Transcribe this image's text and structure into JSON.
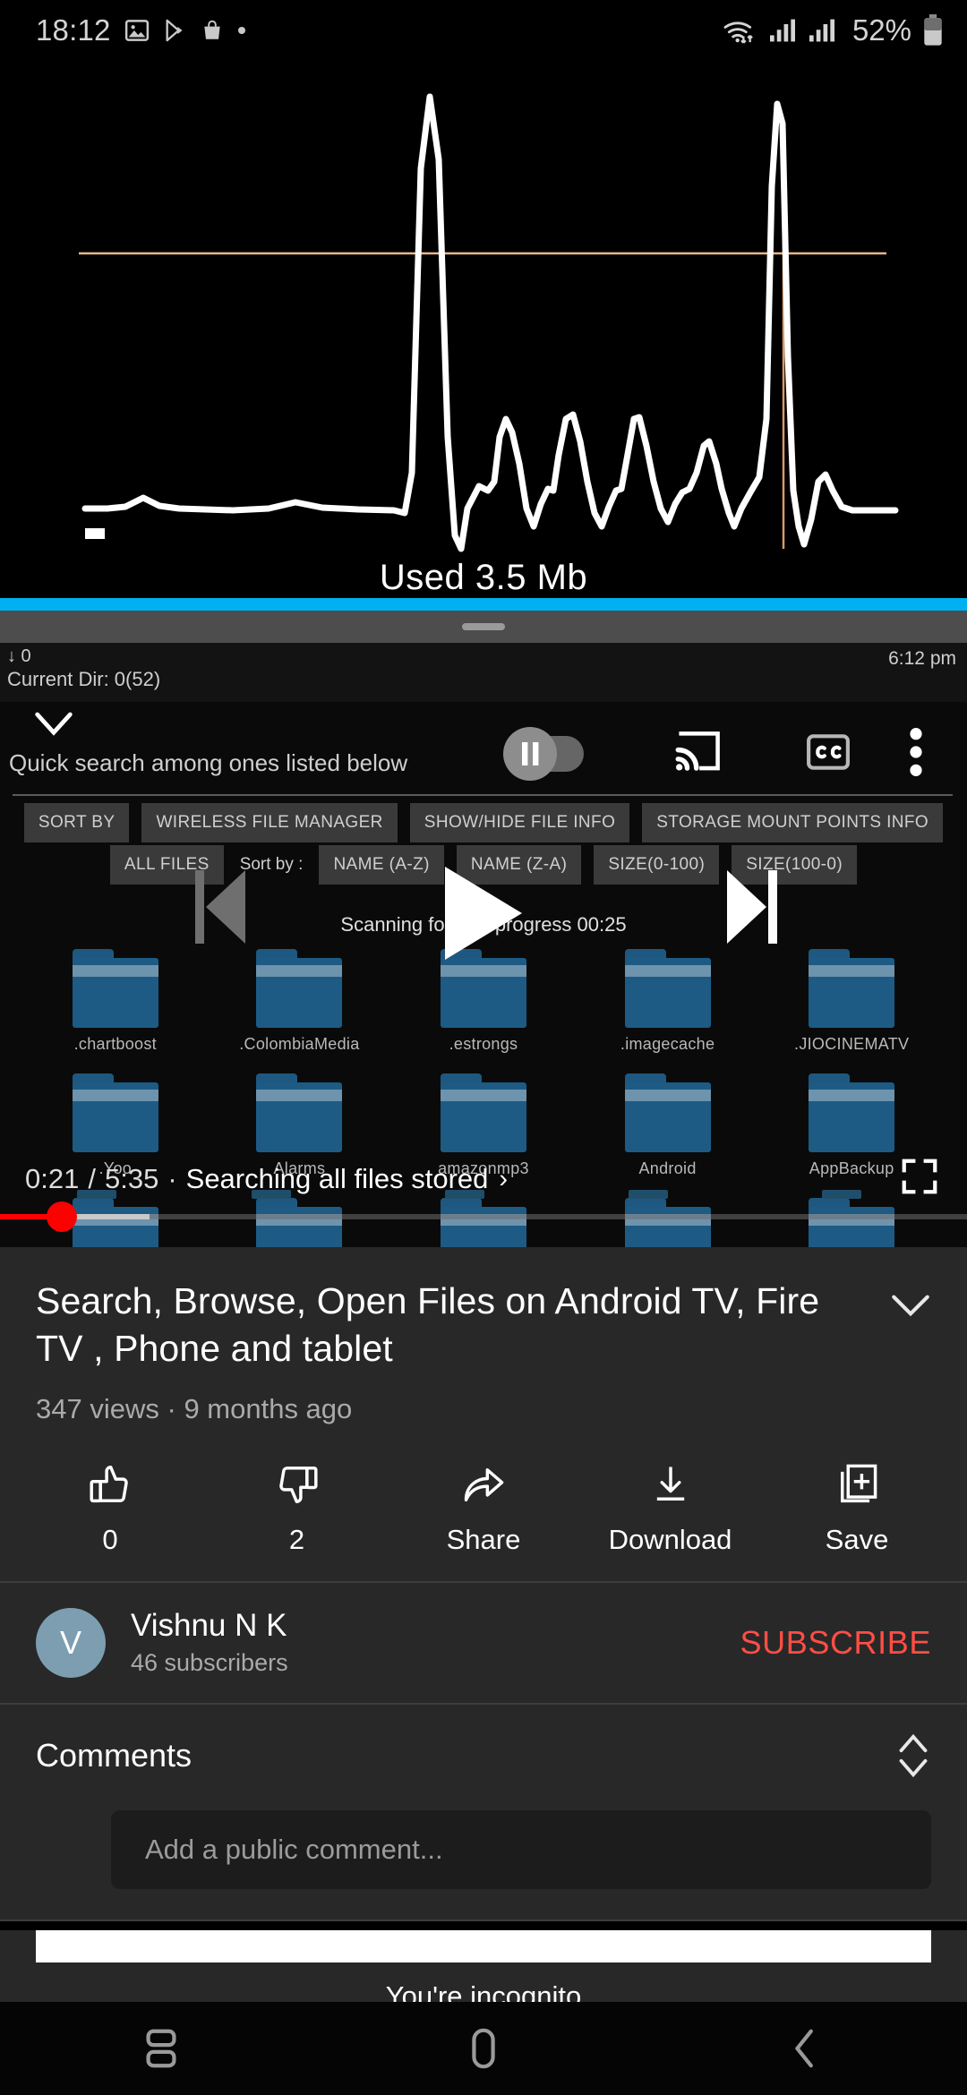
{
  "status_bar": {
    "time": "18:12",
    "battery_percent": "52%",
    "icons": [
      "photos-icon",
      "play-store-icon",
      "shopping-bag-icon",
      "dot-icon",
      "wifi-icon",
      "signal-icon",
      "signal-icon-2",
      "battery-icon"
    ]
  },
  "video": {
    "overlay": {
      "current_time": "0:21",
      "separator": "/",
      "duration": "5:35",
      "dot": "·",
      "chapter": "Searching all files stored",
      "chapter_chevron": "›"
    },
    "content": {
      "used_label": "Used 3.5 Mb",
      "file_manager": {
        "download_count": "↓ 0",
        "current_dir": "Current Dir: 0(52)",
        "clock": "6:12 pm",
        "search_placeholder": "Quick search among ones listed below",
        "toolbar_buttons": [
          "SORT BY",
          "WIRELESS FILE MANAGER",
          "SHOW/HIDE FILE INFO",
          "STORAGE MOUNT POINTS INFO"
        ],
        "filter_button": "ALL FILES",
        "sort_label": "Sort by :",
        "sort_buttons": [
          "NAME (A-Z)",
          "NAME (Z-A)",
          "SIZE(0-100)",
          "SIZE(100-0)"
        ],
        "scanning_text": "Scanning for F in progress 00:25",
        "folders_row1": [
          ".chartboost",
          ".ColombiaMedia",
          ".estrongs",
          ".imagecache",
          ".JIOCINEMATV"
        ],
        "folders_row2": [
          ".Yoo",
          "Alarms",
          "amazonmp3",
          "Android",
          "AppBackup"
        ]
      }
    },
    "progress": {
      "played_percent": 6.3,
      "buffered_percent": 15.5,
      "chapter_marker_positions": [
        8,
        26,
        46,
        65,
        85
      ]
    },
    "controls": [
      "previous-icon",
      "play-icon",
      "next-icon",
      "cast-icon",
      "closed-captions-icon",
      "overflow-menu-icon",
      "autoplay-toggle",
      "fullscreen-icon"
    ]
  },
  "metadata": {
    "title": "Search, Browse, Open Files on Android TV, Fire TV , Phone and tablet",
    "views": "347 views",
    "separator": "·",
    "published": "9 months ago"
  },
  "actions": [
    {
      "name": "like",
      "icon": "thumbs-up-icon",
      "label": "0"
    },
    {
      "name": "dislike",
      "icon": "thumbs-down-icon",
      "label": "2"
    },
    {
      "name": "share",
      "icon": "share-icon",
      "label": "Share"
    },
    {
      "name": "download",
      "icon": "download-icon",
      "label": "Download"
    },
    {
      "name": "save",
      "icon": "save-to-playlist-icon",
      "label": "Save"
    }
  ],
  "channel": {
    "avatar_letter": "V",
    "name": "Vishnu N K",
    "subscribers": "46 subscribers",
    "subscribe_label": "SUBSCRIBE"
  },
  "comments": {
    "heading": "Comments",
    "input_placeholder": "Add a public comment..."
  },
  "incognito": {
    "label": "You're incognito"
  },
  "nav_bar": {
    "buttons": [
      "recents-icon",
      "home-icon",
      "back-icon"
    ]
  },
  "colors": {
    "accent_red": "#ff0000",
    "subscribe_red": "#ff4e45",
    "cyan_bar": "#00b0f0",
    "panel_bg": "#282828",
    "folder_blue": "#1d5b85"
  }
}
